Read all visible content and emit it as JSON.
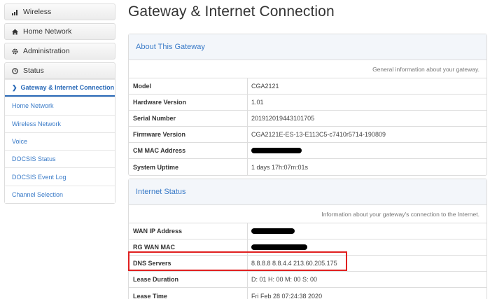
{
  "sidebar": {
    "wireless": "Wireless",
    "home_network": "Home Network",
    "administration": "Administration",
    "status": "Status",
    "status_items": [
      "Gateway & Internet Connection",
      "Home Network",
      "Wireless Network",
      "Voice",
      "DOCSIS Status",
      "DOCSIS Event Log",
      "Channel Selection"
    ]
  },
  "page": {
    "title": "Gateway & Internet Connection"
  },
  "about": {
    "heading": "About This Gateway",
    "description": "General information about your gateway.",
    "rows": [
      {
        "label": "Model",
        "value": "CGA2121"
      },
      {
        "label": "Hardware Version",
        "value": "1.01"
      },
      {
        "label": "Serial Number",
        "value": "201912019443101705"
      },
      {
        "label": "Firmware Version",
        "value": "CGA2121E-ES-13-E113C5-c7410r5714-190809"
      },
      {
        "label": "CM MAC Address",
        "value": ""
      },
      {
        "label": "System Uptime",
        "value": "1 days 17h:07m:01s"
      }
    ]
  },
  "internet": {
    "heading": "Internet Status",
    "description": "Information about your gateway's connection to the Internet.",
    "rows": [
      {
        "label": "WAN IP Address",
        "value": ""
      },
      {
        "label": "RG WAN MAC",
        "value": ""
      },
      {
        "label": "DNS Servers",
        "value": "8.8.8.8 8.8.4.4 213.60.205.175"
      },
      {
        "label": "Lease Duration",
        "value": "D: 01 H: 00 M: 00 S: 00"
      },
      {
        "label": "Lease Time",
        "value": "Fri Feb 28 07:24:38 2020"
      }
    ]
  },
  "colors": {
    "link": "#3a7bc8",
    "highlight_border": "#e02020"
  },
  "icons": [
    "signal-icon",
    "home-icon",
    "gear-icon",
    "clock-icon",
    "chevron-right-icon"
  ]
}
